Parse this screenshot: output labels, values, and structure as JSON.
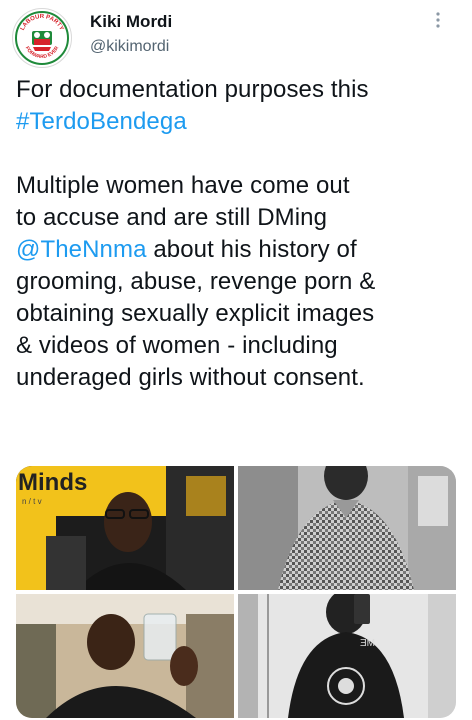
{
  "author": {
    "display_name": "Kiki Mordi",
    "handle": "@kikimordi",
    "avatar_text_top": "LABOUR PARTY",
    "avatar_text_bottom": "FORWARD EVER",
    "avatar_colors": {
      "green": "#1f8a3a",
      "red": "#d6232b",
      "white": "#ffffff"
    }
  },
  "menu": {
    "icon": "more-vertical-icon"
  },
  "tweet": {
    "line1": "For documentation purposes this",
    "hashtag": "#TerdoBendega",
    "p2_line1": "Multiple women have come out",
    "p2_line2": "to accuse and are still DMing",
    "mention": "@TheNnma",
    "p2_line3_rest": " about his history of",
    "p2_line4": "grooming, abuse, revenge porn &",
    "p2_line5": "obtaining sexually explicit images",
    "p2_line6": "& videos of women - including",
    "p2_line7": "underaged girls without consent."
  },
  "media": {
    "photo1": {
      "sign_text": "Minds",
      "sign_subtext": "n / t v"
    },
    "photo4": {
      "shirt_text": "ƎM"
    },
    "colors": {
      "link": "#1d9bf0",
      "sign_yellow": "#f2c21b"
    }
  }
}
